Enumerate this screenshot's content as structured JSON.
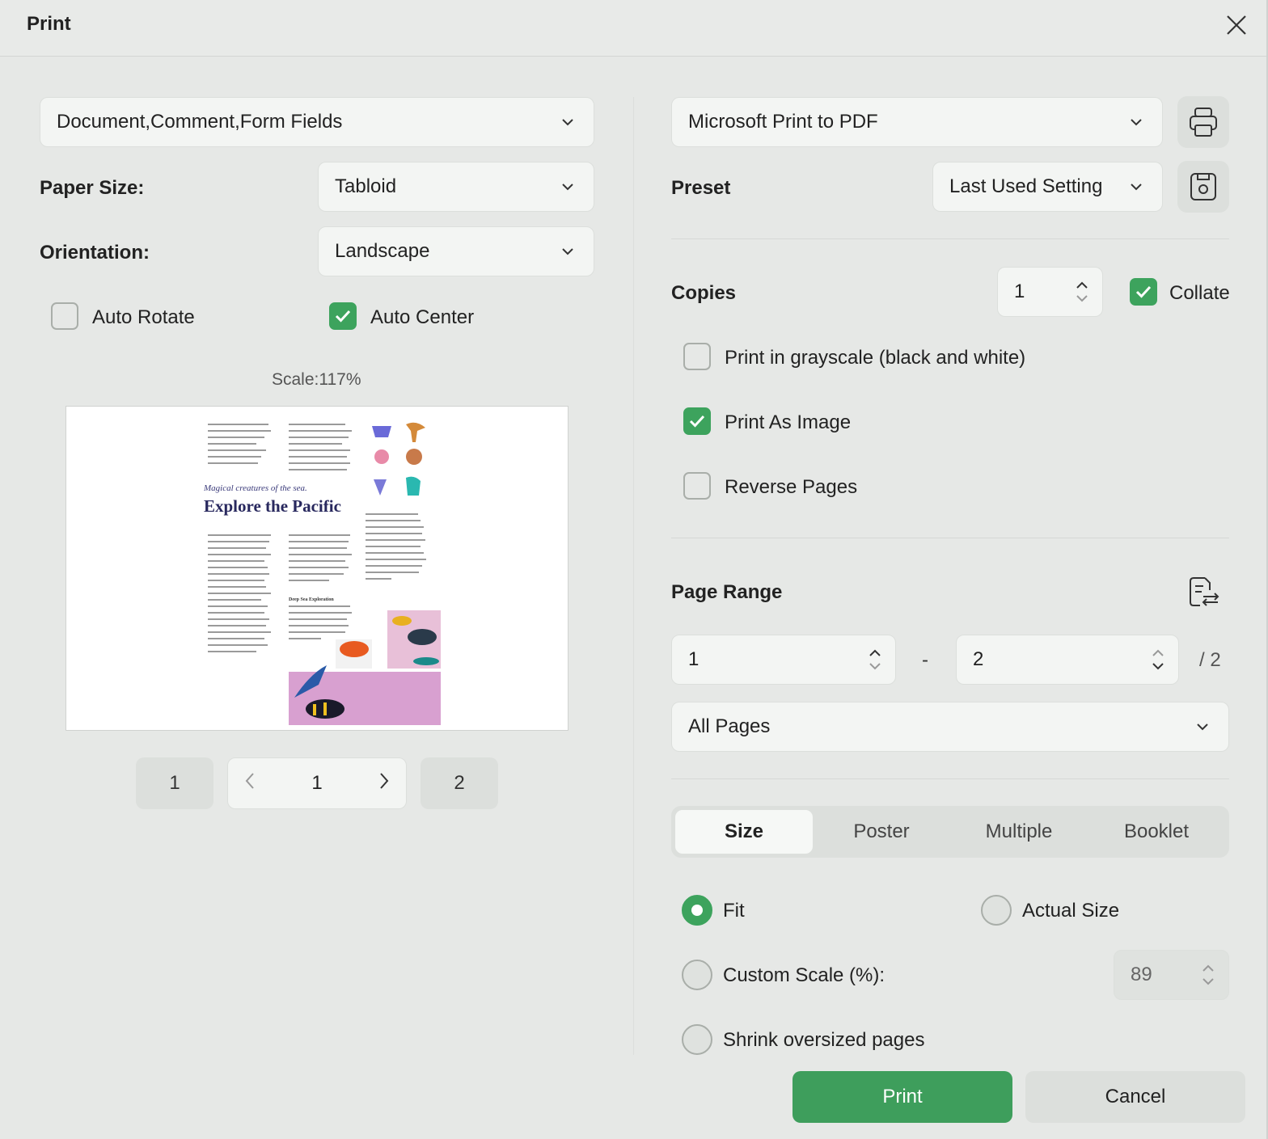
{
  "window": {
    "title": "Print"
  },
  "left": {
    "content_select": "Document,Comment,Form Fields",
    "paper_size": {
      "label": "Paper Size:",
      "value": "Tabloid"
    },
    "orientation": {
      "label": "Orientation:",
      "value": "Landscape"
    },
    "auto_rotate": {
      "label": "Auto Rotate",
      "checked": false
    },
    "auto_center": {
      "label": "Auto Center",
      "checked": true
    },
    "scale_text": "Scale:117%",
    "preview": {
      "subtitle": "Magical creatures of the sea.",
      "heading": "Explore the Pacific",
      "section": "Deep Sea Exploration"
    },
    "pager": {
      "first": "1",
      "current": "1",
      "last": "2"
    }
  },
  "right": {
    "printer": "Microsoft Print to PDF",
    "preset": {
      "label": "Preset",
      "value": "Last Used Setting"
    },
    "copies": {
      "label": "Copies",
      "value": "1"
    },
    "collate": {
      "label": "Collate",
      "checked": true
    },
    "grayscale": {
      "label": "Print in grayscale (black and white)",
      "checked": false
    },
    "print_as_image": {
      "label": "Print As Image",
      "checked": true
    },
    "reverse_pages": {
      "label": "Reverse Pages",
      "checked": false
    },
    "page_range": {
      "label": "Page Range",
      "from": "1",
      "separator": "-",
      "to": "2",
      "total": "/ 2",
      "select": "All Pages"
    },
    "tabs": [
      "Size",
      "Poster",
      "Multiple",
      "Booklet"
    ],
    "active_tab": "Size",
    "sizing": {
      "fit": "Fit",
      "actual_size": "Actual Size",
      "custom_scale": "Custom Scale (%):",
      "custom_scale_value": "89",
      "shrink": "Shrink oversized pages",
      "selected": "Fit"
    }
  },
  "buttons": {
    "print": "Print",
    "cancel": "Cancel"
  },
  "colors": {
    "accent": "#3da35d",
    "background": "#e6e8e6"
  }
}
